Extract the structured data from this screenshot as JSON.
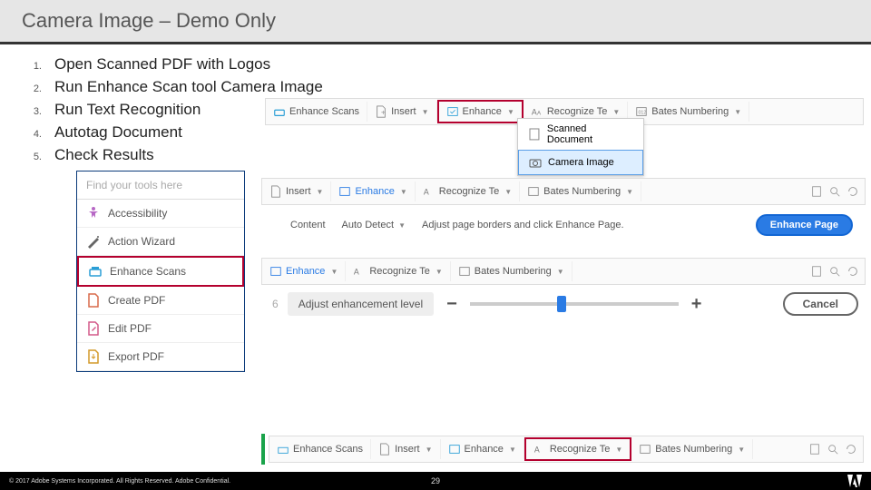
{
  "title": "Camera Image – Demo Only",
  "steps": [
    "Open Scanned PDF with Logos",
    "Run Enhance Scan tool Camera Image",
    "Run Text Recognition",
    "Autotag Document",
    "Check Results"
  ],
  "tools_panel": {
    "search_placeholder": "Find your tools here",
    "items": [
      "Accessibility",
      "Action Wizard",
      "Enhance Scans",
      "Create PDF",
      "Edit PDF",
      "Export PDF"
    ],
    "highlight_index": 2
  },
  "strip1": {
    "label": "Enhance Scans",
    "buttons": [
      "Insert",
      "Enhance",
      "Recognize Te",
      "Bates Numbering"
    ],
    "popup": [
      "Scanned Document",
      "Camera Image"
    ],
    "popup_selected": 1
  },
  "strip2": {
    "buttons": [
      "Insert",
      "Enhance",
      "Recognize Te",
      "Bates Numbering"
    ],
    "opts": {
      "content_label": "Content",
      "content_value": "Auto Detect",
      "adjust_text": "Adjust page borders and click Enhance Page.",
      "action": "Enhance Page"
    }
  },
  "strip3": {
    "buttons": [
      "Enhance",
      "Recognize Te",
      "Bates Numbering"
    ],
    "slider_label": "Adjust enhancement level",
    "cancel": "Cancel"
  },
  "strip4": {
    "label": "Enhance Scans",
    "buttons": [
      "Insert",
      "Enhance",
      "Recognize Te",
      "Bates Numbering"
    ]
  },
  "footer": {
    "copyright": "© 2017 Adobe Systems Incorporated.  All Rights Reserved.  Adobe Confidential.",
    "page": "29"
  }
}
